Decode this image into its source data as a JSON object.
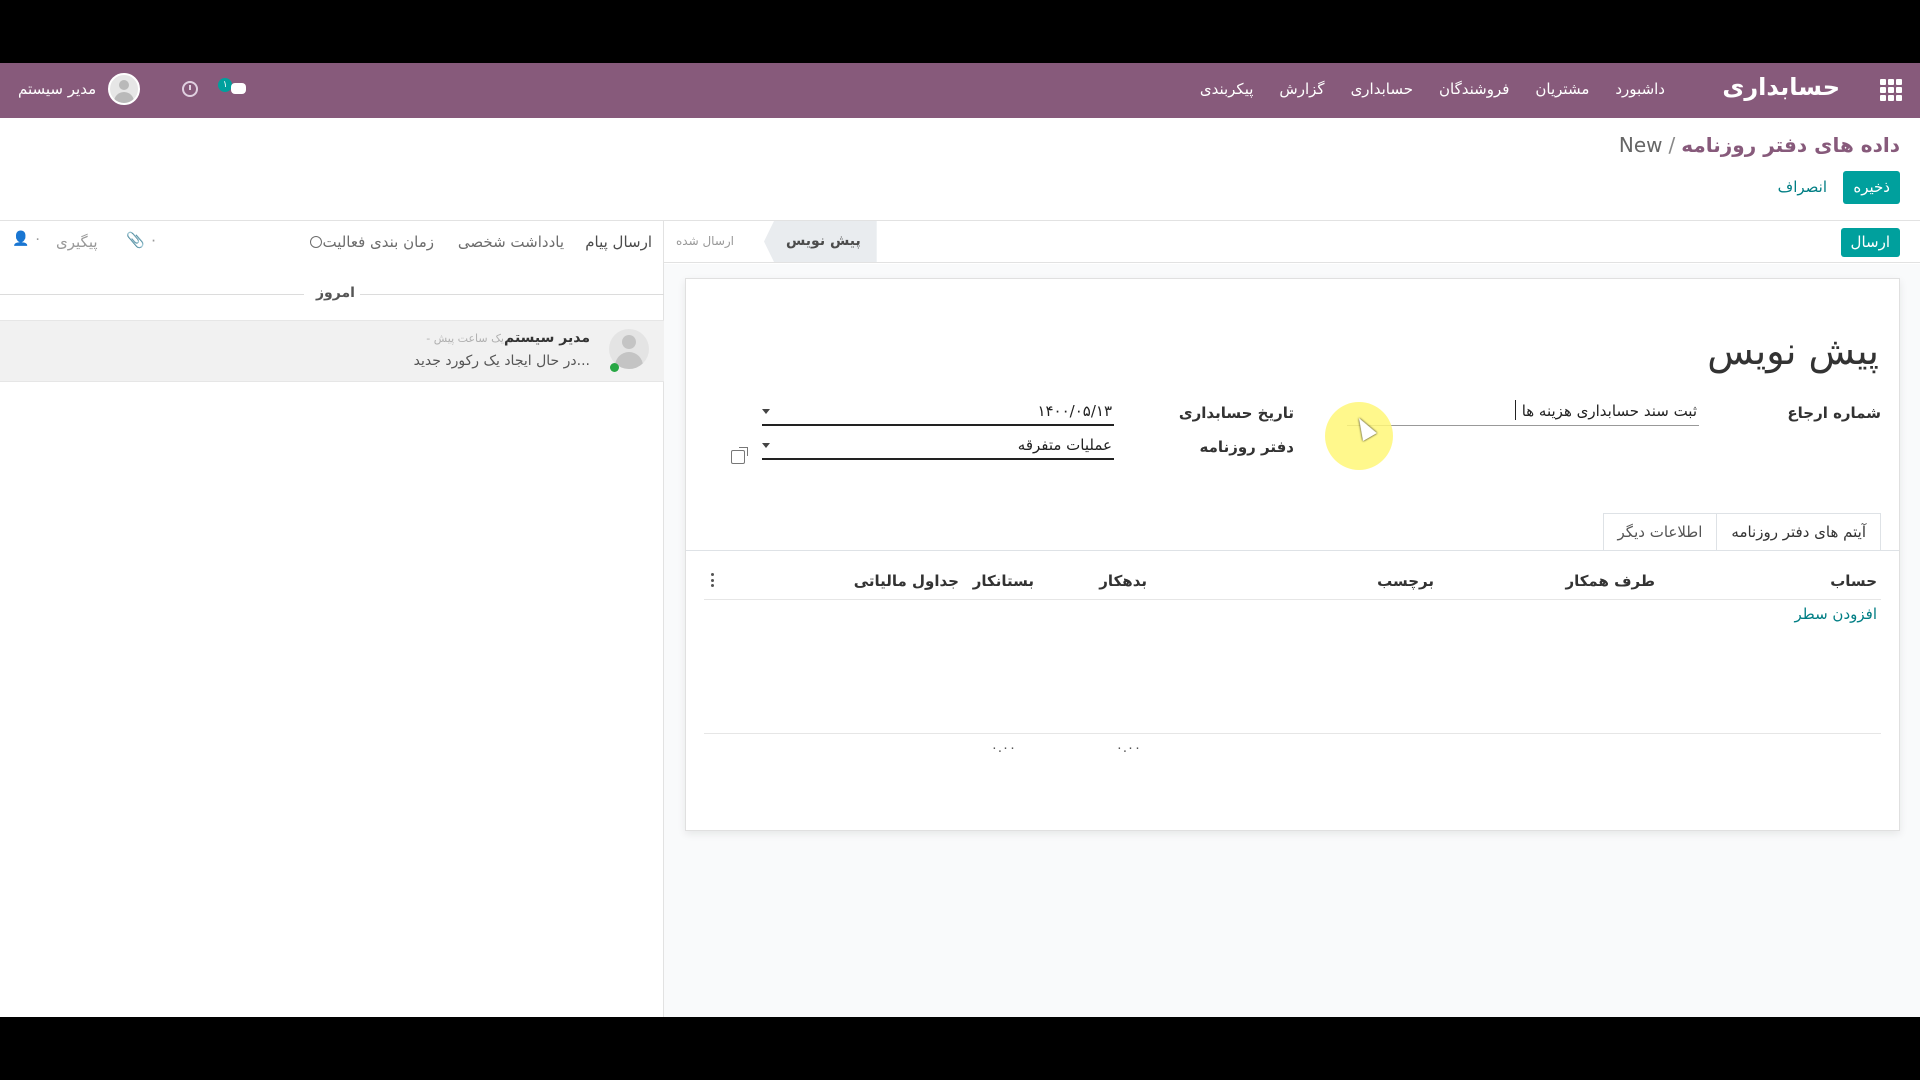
{
  "navbar": {
    "brand": "حسابداری",
    "menu": [
      "داشبورد",
      "مشتریان",
      "فروشندگان",
      "حسابداری",
      "گزارش",
      "پیکربندی"
    ],
    "user_name": "مدیر سیستم",
    "chat_badge": "۱"
  },
  "breadcrumb": {
    "parent": "داده های دفتر روزنامه",
    "separator": "/",
    "current": "New"
  },
  "buttons": {
    "save": "ذخیره",
    "discard": "انصراف",
    "post": "ارسال"
  },
  "statusbar": {
    "draft": "پیش نویس",
    "posted": "ارسال شده"
  },
  "chatter": {
    "send_message": "ارسال پیام",
    "log_note": "یادداشت شخصی",
    "schedule_activity": "زمان بندی فعالیت",
    "attachments_count": "۰",
    "follow": "پیگیری",
    "followers_count": "۰",
    "today": "امروز",
    "message": {
      "author": "مدیر سیستم",
      "time": "- یک ساعت پیش",
      "body": "در حال ایجاد یک رکورد جدید..."
    }
  },
  "form": {
    "title": "پیش نویس",
    "ref_label": "شماره ارجاع",
    "ref_value": "ثبت سند حسابداری هزینه ها",
    "date_label": "تاریخ حسابداری",
    "date_value": "۱۴۰۰/۰۵/۱۳",
    "journal_label": "دفتر روزنامه",
    "journal_value": "عملیات متفرقه",
    "tabs": [
      "آیتم های دفتر روزنامه",
      "اطلاعات دیگر"
    ],
    "columns": {
      "account": "حساب",
      "partner": "طرف همکار",
      "label": "برچسب",
      "debit": "بدهکار",
      "credit": "بستانکار",
      "taxes": "جداول مالیاتی"
    },
    "add_line": "افزودن سطر",
    "total_debit": "۰.۰۰",
    "total_credit": "۰.۰۰"
  },
  "icons": {
    "apps": "apps-grid-icon",
    "clock": "clock-icon",
    "chat": "chat-icon",
    "external": "external-link-icon"
  },
  "colors": {
    "brand": "#875a7b",
    "primary": "#00a09d",
    "link": "#017e84"
  }
}
